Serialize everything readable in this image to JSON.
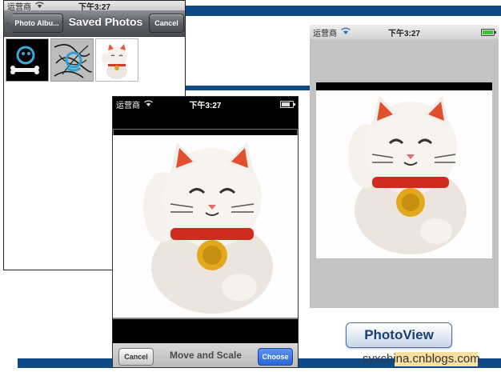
{
  "left_phone": {
    "status": {
      "carrier": "运营商",
      "time": "下午3:27"
    },
    "nav": {
      "back_label": "Photo Albu...",
      "title": "Saved Photos",
      "cancel_label": "Cancel"
    }
  },
  "middle_phone": {
    "status": {
      "carrier": "运营商",
      "time": "下午3:27"
    },
    "toolbar": {
      "cancel_label": "Cancel",
      "title": "Move and Scale",
      "choose_label": "Choose"
    }
  },
  "right_phone": {
    "status": {
      "carrier": "运营商",
      "time": "下午3:27"
    }
  },
  "photoview_button": {
    "label": "PhotoView"
  },
  "watermark": {
    "text": "syxchina.cnblogs.com"
  },
  "colors": {
    "accent_blue": "#0d4a86",
    "choose_blue": "#2a66d6"
  }
}
